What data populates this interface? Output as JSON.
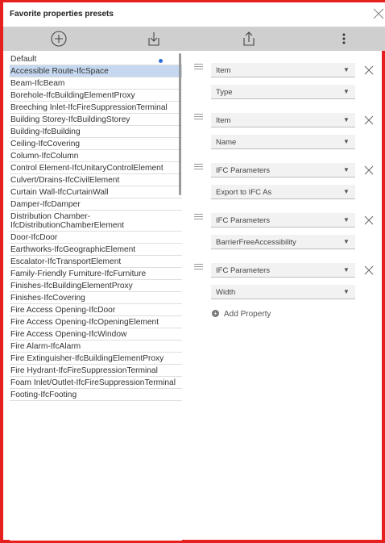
{
  "window": {
    "title": "Favorite properties presets"
  },
  "toolbar": {
    "add_icon": "plus-circle-icon",
    "import_icon": "import-icon",
    "export_icon": "share-icon",
    "menu_icon": "more-vert-icon"
  },
  "presets": [
    {
      "label": "Default",
      "active_dot": true
    },
    {
      "label": "Accessible Route-IfcSpace",
      "selected": true
    },
    {
      "label": "Beam-IfcBeam"
    },
    {
      "label": "Borehole-IfcBuildingElementProxy"
    },
    {
      "label": "Breeching Inlet-IfcFireSuppressionTerminal"
    },
    {
      "label": "Building Storey-IfcBuildingStorey"
    },
    {
      "label": "Building-IfcBuilding"
    },
    {
      "label": "Ceiling-IfcCovering"
    },
    {
      "label": "Column-IfcColumn"
    },
    {
      "label": "Control Element-IfcUnitaryControlElement"
    },
    {
      "label": "Culvert/Drains-IfcCivilElement"
    },
    {
      "label": "Curtain Wall-IfcCurtainWall"
    },
    {
      "label": "Damper-IfcDamper"
    },
    {
      "label": "Distribution Chamber-IfcDistributionChamberElement"
    },
    {
      "label": "Door-IfcDoor"
    },
    {
      "label": "Earthworks-IfcGeographicElement"
    },
    {
      "label": "Escalator-IfcTransportElement"
    },
    {
      "label": "Family-Friendly Furniture-IfcFurniture"
    },
    {
      "label": "Finishes-IfcBuildingElementProxy"
    },
    {
      "label": "Finishes-IfcCovering"
    },
    {
      "label": "Fire Access Opening-IfcDoor"
    },
    {
      "label": "Fire Access Opening-IfcOpeningElement"
    },
    {
      "label": "Fire Access Opening-IfcWindow"
    },
    {
      "label": "Fire Alarm-IfcAlarm"
    },
    {
      "label": "Fire Extinguisher-IfcBuildingElementProxy"
    },
    {
      "label": "Fire Hydrant-IfcFireSuppressionTerminal"
    },
    {
      "label": "Foam Inlet/Outlet-IfcFireSuppressionTerminal"
    },
    {
      "label": "Footing-IfcFooting"
    }
  ],
  "properties": [
    {
      "group": "Item",
      "property": "Type"
    },
    {
      "group": "Item",
      "property": "Name"
    },
    {
      "group": "IFC Parameters",
      "property": "Export to IFC As"
    },
    {
      "group": "IFC Parameters",
      "property": "BarrierFreeAccessibility"
    },
    {
      "group": "IFC Parameters",
      "property": "Width"
    }
  ],
  "add_property_label": "Add Property",
  "colors": {
    "frame": "#e61f1f",
    "selected": "#c5d8f0",
    "dot": "#2f6fdc",
    "toolbar": "#cfcfcf"
  }
}
